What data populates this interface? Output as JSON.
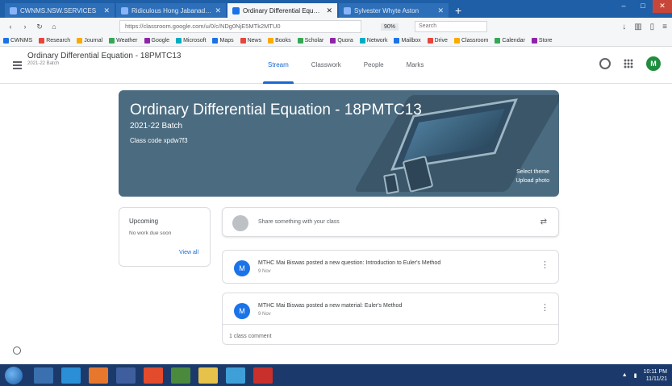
{
  "browser": {
    "tabs": [
      {
        "label": "CWNMS.NSW.SERVICES",
        "active": false
      },
      {
        "label": "Ridiculous Hong Jabanad Chrome",
        "active": false
      },
      {
        "label": "Ordinary Differential Equation",
        "active": true
      },
      {
        "label": "Sylvester Whyte Aston",
        "active": false
      }
    ],
    "new_tab": "+",
    "url": "https://classroom.google.com/u/0/c/NDg0NjE5MTk2MTU0",
    "zoom": "90%",
    "search_placeholder": "Search",
    "bookmarks": [
      "CWNMS",
      "Research",
      "Journal",
      "Weather",
      "Google",
      "Microsoft",
      "Maps",
      "News",
      "Books",
      "Scholar",
      "Quora",
      "Network",
      "Mailbox",
      "Drive",
      "Classroom",
      "Calendar",
      "Store"
    ]
  },
  "classroom": {
    "class_title": "Ordinary Differential Equation - 18PMTC13",
    "class_subtitle": "2021-22 Batch",
    "tabs": [
      {
        "label": "Stream",
        "active": true
      },
      {
        "label": "Classwork",
        "active": false
      },
      {
        "label": "People",
        "active": false
      },
      {
        "label": "Marks",
        "active": false
      }
    ],
    "avatar_letter": "M"
  },
  "banner": {
    "title": "Ordinary Differential Equation - 18PMTC13",
    "batch": "2021-22 Batch",
    "class_code": "Class code  xpdw7f3",
    "select_theme": "Select theme",
    "upload_photo": "Upload photo"
  },
  "upcoming": {
    "title": "Upcoming",
    "text": "No work due soon",
    "view_all": "View all"
  },
  "stream": {
    "share_placeholder": "Share something with your class",
    "posts": [
      {
        "avatar": "M",
        "title": "MTHC Mai Biswas posted a new question: Introduction to Euler's Method",
        "date": "9 Nov"
      },
      {
        "avatar": "M",
        "title": "MTHC Mai Biswas posted a new material: Euler's Method",
        "date": "9 Nov",
        "comment": "1 class comment"
      }
    ]
  },
  "taskbar": {
    "time": "10:11 PM",
    "date": "11/11/21"
  }
}
